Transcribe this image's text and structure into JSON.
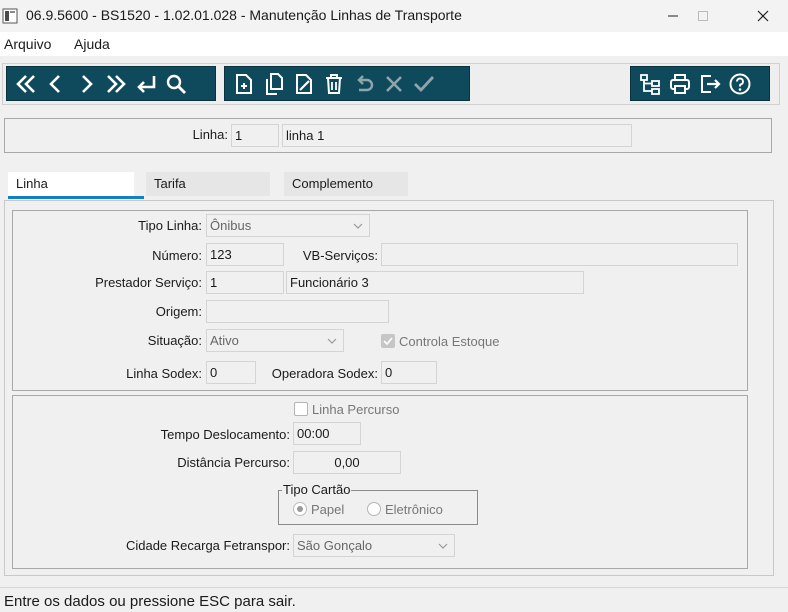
{
  "window": {
    "title": "06.9.5600 - BS1520 - 1.02.01.028 - Manutenção Linhas de Transporte"
  },
  "menu": {
    "items": [
      {
        "label": "Arquivo"
      },
      {
        "label": "Ajuda"
      }
    ]
  },
  "toolbar": {
    "nav_icons": [
      "first-icon",
      "previous-icon",
      "next-icon",
      "last-icon",
      "goto-icon",
      "search-icon"
    ],
    "edit_icons": [
      "new-icon",
      "copy-icon",
      "edit-icon",
      "delete-icon",
      "undo-icon",
      "cancel-icon",
      "confirm-icon"
    ],
    "right_icons": [
      "hierarchy-icon",
      "print-icon",
      "exit-icon",
      "help-icon"
    ],
    "color": "#0f4a5c"
  },
  "header": {
    "linha_label": "Linha:",
    "linha_code": "1",
    "linha_desc": "linha 1"
  },
  "tabs": [
    {
      "label": "Linha",
      "active": true
    },
    {
      "label": "Tarifa",
      "active": false
    },
    {
      "label": "Complemento",
      "active": false
    }
  ],
  "linha_tab": {
    "tipo_linha_label": "Tipo Linha:",
    "tipo_linha_value": "Ônibus",
    "numero_label": "Número:",
    "numero_value": "123",
    "vb_servicos_label": "VB-Serviços:",
    "vb_servicos_value": "",
    "prestador_label": "Prestador Serviço:",
    "prestador_code": "1",
    "prestador_name": "Funcionário 3",
    "origem_label": "Origem:",
    "origem_value": "",
    "situacao_label": "Situação:",
    "situacao_value": "Ativo",
    "controla_estoque_label": "Controla Estoque",
    "controla_estoque_checked": true,
    "linha_sodex_label": "Linha Sodex:",
    "linha_sodex_value": "0",
    "operadora_sodex_label": "Operadora Sodex:",
    "operadora_sodex_value": "0",
    "linha_percurso_label": "Linha Percurso",
    "linha_percurso_checked": false,
    "tempo_label": "Tempo Deslocamento:",
    "tempo_value": "00:00",
    "distancia_label": "Distância Percurso:",
    "distancia_value": "0,00",
    "tipo_cartao_label": "Tipo Cartão",
    "tipo_cartao_options": [
      {
        "label": "Papel",
        "selected": true
      },
      {
        "label": "Eletrônico",
        "selected": false
      }
    ],
    "cidade_label": "Cidade Recarga Fetranspor:",
    "cidade_value": "São Gonçalo"
  },
  "status": {
    "text": "Entre os dados ou pressione ESC para sair."
  }
}
